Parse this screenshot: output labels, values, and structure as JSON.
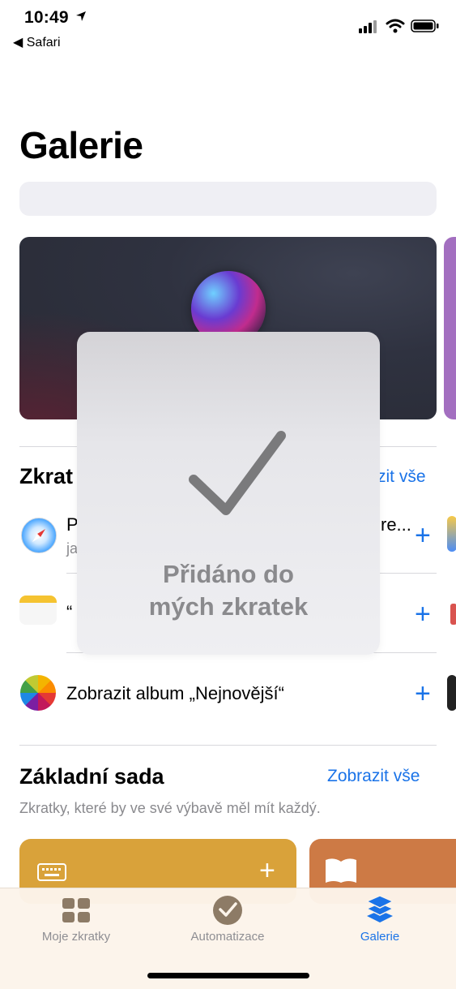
{
  "status_bar": {
    "time": "10:49",
    "back_label": "◀ Safari"
  },
  "page": {
    "title": "Galerie"
  },
  "section_shortcuts": {
    "title": "Zkrat",
    "link": "zit vše",
    "rows": [
      {
        "text": "P",
        "text_right": "re...",
        "subtitle": "ja"
      },
      {
        "text": "“"
      },
      {
        "text": "Zobrazit album „Nejnovější“"
      }
    ]
  },
  "section_basic": {
    "title": "Základní sada",
    "link": "Zobrazit vše",
    "subtitle": "Zkratky, které by ve své výbavě měl mít každý."
  },
  "overlay": {
    "line1": "Přidáno do",
    "line2": "mých zkratek"
  },
  "tabbar": {
    "tabs": [
      {
        "label": "Moje zkratky"
      },
      {
        "label": "Automatizace"
      },
      {
        "label": "Galerie"
      }
    ]
  },
  "colors": {
    "accent": "#1a73e8",
    "inactive_tab": "#8e8e93"
  }
}
